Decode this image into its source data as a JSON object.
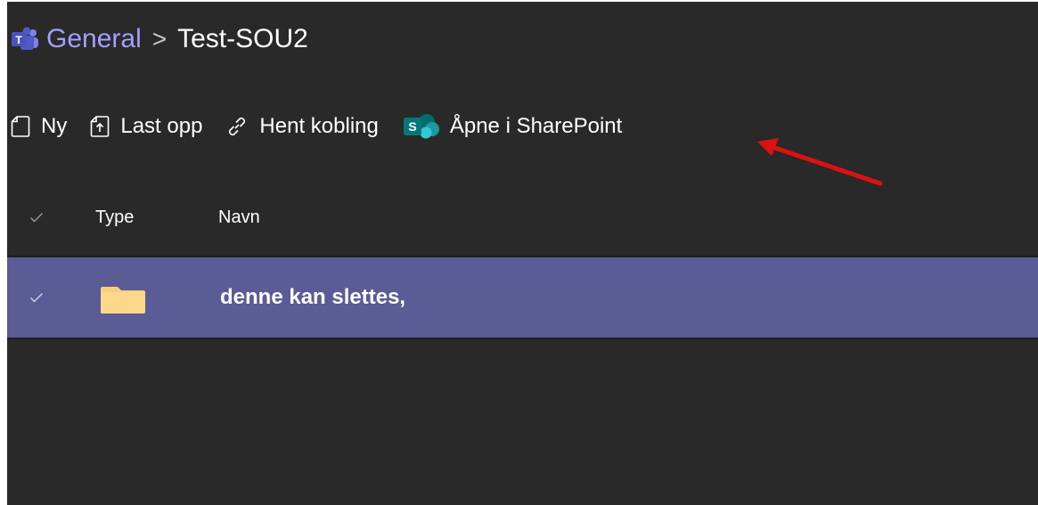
{
  "breadcrumb": {
    "parent": "General",
    "separator": ">",
    "current": "Test-SOU2"
  },
  "toolbar": {
    "new_label": "Ny",
    "upload_label": "Last opp",
    "get_link_label": "Hent kobling",
    "open_sharepoint_label": "Åpne i SharePoint"
  },
  "columns": {
    "type": "Type",
    "name": "Navn"
  },
  "rows": [
    {
      "name": "denne kan slettes,",
      "type": "folder",
      "selected": true
    }
  ],
  "colors": {
    "background": "#292929",
    "selected_row": "#5b5b96",
    "breadcrumb_link": "#9ea2ff",
    "annotation_arrow": "#e01010"
  }
}
